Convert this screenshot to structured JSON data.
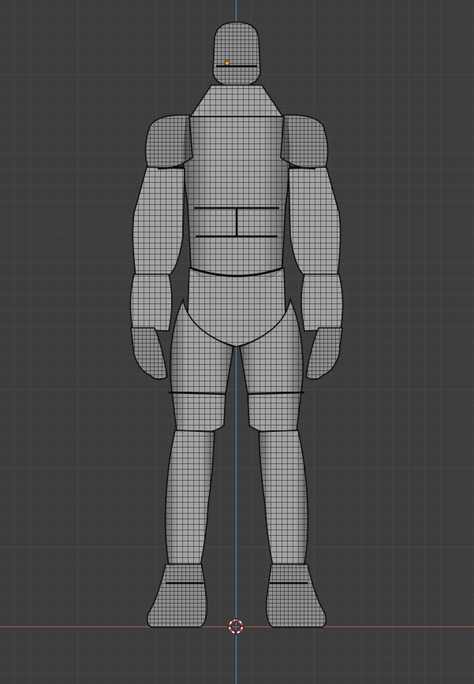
{
  "scene": {
    "object": "humanoid-mesh",
    "view": "front-orthographic",
    "display": "wireframe-over-solid",
    "colors": {
      "background": "#3d3d3d",
      "grid": "#464646",
      "z_axis": "#4a79c9",
      "x_axis": "#b34a4a",
      "mesh_fill": "#9a9a9a",
      "mesh_wire": "#1a1a1a",
      "origin_dot": "#f0a020",
      "cursor_red": "#e0373a",
      "cursor_white": "#ffffff"
    }
  }
}
